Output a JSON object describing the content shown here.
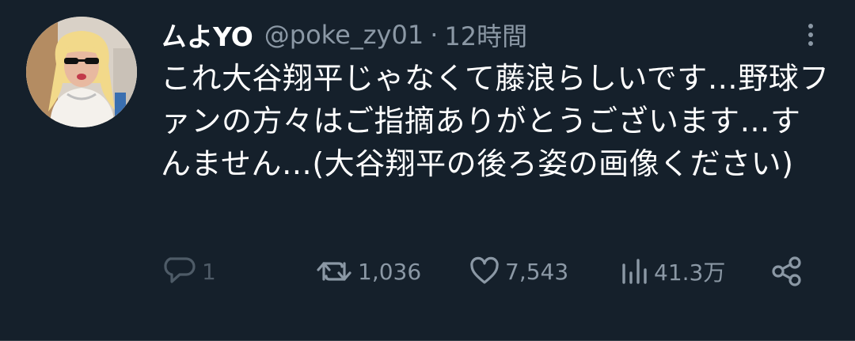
{
  "tweet": {
    "display_name": "ㄙよYO",
    "handle": "@poke_zy01",
    "separator": "·",
    "time": "12時間",
    "text": "これ大谷翔平じゃなくて藤浪らしいです…野球ファンの方々はご指摘ありがとうございます…すんません…(大谷翔平の後ろ姿の画像ください)"
  },
  "actions": {
    "reply_count": "1",
    "retweet_count": "1,036",
    "like_count": "7,543",
    "views_count": "41.3万"
  },
  "icons": {
    "reply": "reply-icon",
    "retweet": "retweet-icon",
    "like": "heart-icon",
    "views": "views-icon",
    "share": "share-icon",
    "more": "more-vertical-icon"
  },
  "colors": {
    "background": "#15202b",
    "text_primary": "#ffffff",
    "text_secondary": "#8b98a5",
    "reply_dim": "#4e5b67"
  }
}
